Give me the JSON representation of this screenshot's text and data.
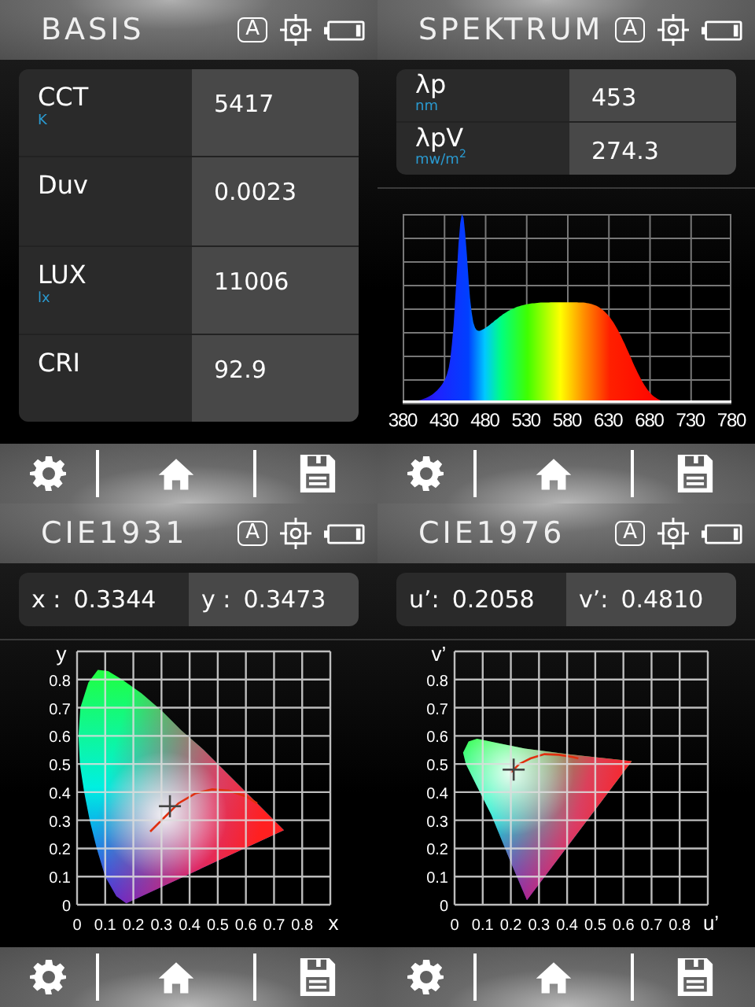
{
  "panels": [
    {
      "kind": "basis",
      "title": "BASIS",
      "mode": "A",
      "rows": [
        {
          "label": "CCT",
          "unit": "K",
          "value": "5417"
        },
        {
          "label": "Duv",
          "value": "0.0023"
        },
        {
          "label": "LUX",
          "unit": "lx",
          "value": "11006"
        },
        {
          "label": "CRI",
          "value": "92.9"
        }
      ]
    },
    {
      "kind": "spectrum",
      "title": "SPEKTRUM",
      "mode": "A",
      "rows": [
        {
          "label": "λp",
          "unit": "nm",
          "value": "453"
        },
        {
          "label": "λpV",
          "unit": "mw/m$^{2}$",
          "value": "274.3"
        }
      ],
      "axis_labels": [
        "380",
        "430",
        "480",
        "530",
        "580",
        "630",
        "680",
        "730",
        "780"
      ]
    },
    {
      "kind": "cie",
      "title": "CIE1931",
      "mode": "A",
      "coords": [
        {
          "label": "x :",
          "value": "0.3344"
        },
        {
          "label": "y :",
          "value": "0.3473"
        }
      ],
      "chart_data": {
        "type": "scatter",
        "grid": true,
        "xlabel": "x",
        "ylabel": "y",
        "x": [
          0.33
        ],
        "values": [
          0.35
        ],
        "xlim": [
          0,
          0.9
        ],
        "ylim": [
          0,
          0.9
        ],
        "xticks": [
          0,
          0.1,
          0.2,
          0.3,
          0.4,
          0.5,
          0.6,
          0.7,
          0.8
        ],
        "yticks": [
          0,
          0.1,
          0.2,
          0.3,
          0.4,
          0.5,
          0.6,
          0.7,
          0.8
        ]
      }
    },
    {
      "kind": "cie",
      "title": "CIE1976",
      "mode": "A",
      "coords": [
        {
          "label": "u’:",
          "value": "0.2058"
        },
        {
          "label": "v’:",
          "value": "0.4810"
        }
      ],
      "chart_data": {
        "type": "scatter",
        "grid": true,
        "xlabel": "u’",
        "ylabel": "v’",
        "x": [
          0.21
        ],
        "values": [
          0.48
        ],
        "xlim": [
          0,
          0.9
        ],
        "ylim": [
          0,
          0.9
        ],
        "xticks": [
          0,
          0.1,
          0.2,
          0.3,
          0.4,
          0.5,
          0.6,
          0.7,
          0.8
        ],
        "yticks": [
          0,
          0.1,
          0.2,
          0.3,
          0.4,
          0.5,
          0.6,
          0.7,
          0.8
        ]
      }
    }
  ]
}
